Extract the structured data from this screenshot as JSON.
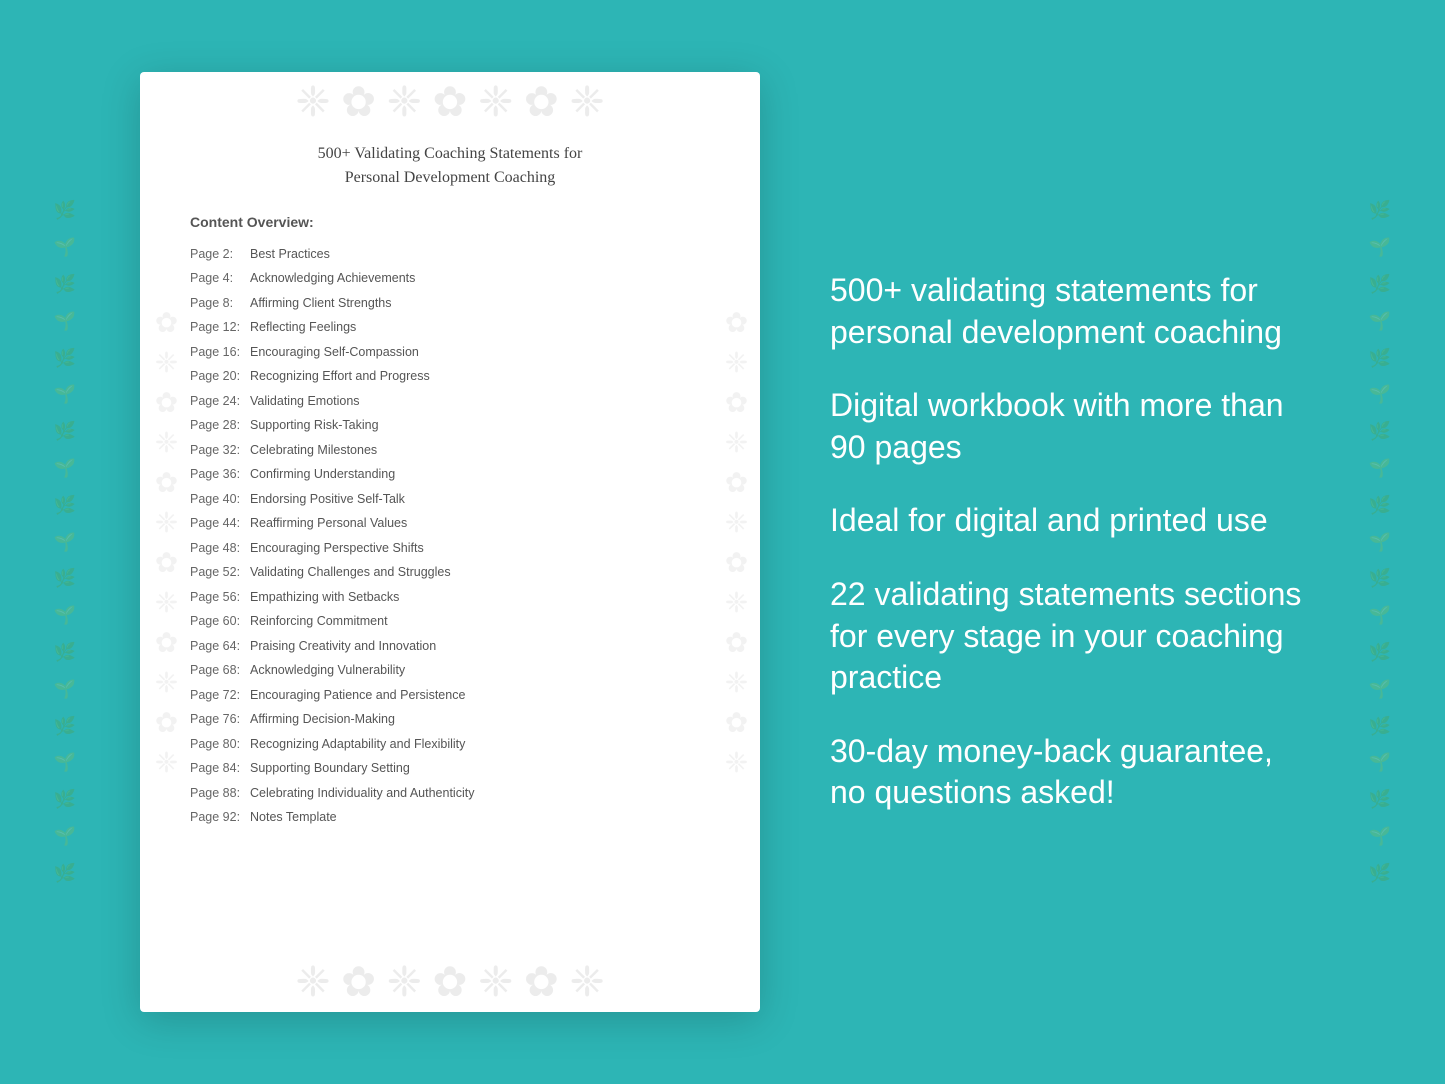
{
  "background": {
    "color": "#38bcbc"
  },
  "document": {
    "title_line1": "500+ Validating Coaching Statements for",
    "title_line2": "Personal Development Coaching",
    "content_heading": "Content Overview:",
    "toc": [
      {
        "page": "Page  2:",
        "topic": "Best Practices"
      },
      {
        "page": "Page  4:",
        "topic": "Acknowledging Achievements"
      },
      {
        "page": "Page  8:",
        "topic": "Affirming Client Strengths"
      },
      {
        "page": "Page 12:",
        "topic": "Reflecting Feelings"
      },
      {
        "page": "Page 16:",
        "topic": "Encouraging Self-Compassion"
      },
      {
        "page": "Page 20:",
        "topic": "Recognizing Effort and Progress"
      },
      {
        "page": "Page 24:",
        "topic": "Validating Emotions"
      },
      {
        "page": "Page 28:",
        "topic": "Supporting Risk-Taking"
      },
      {
        "page": "Page 32:",
        "topic": "Celebrating Milestones"
      },
      {
        "page": "Page 36:",
        "topic": "Confirming Understanding"
      },
      {
        "page": "Page 40:",
        "topic": "Endorsing Positive Self-Talk"
      },
      {
        "page": "Page 44:",
        "topic": "Reaffirming Personal Values"
      },
      {
        "page": "Page 48:",
        "topic": "Encouraging Perspective Shifts"
      },
      {
        "page": "Page 52:",
        "topic": "Validating Challenges and Struggles"
      },
      {
        "page": "Page 56:",
        "topic": "Empathizing with Setbacks"
      },
      {
        "page": "Page 60:",
        "topic": "Reinforcing Commitment"
      },
      {
        "page": "Page 64:",
        "topic": "Praising Creativity and Innovation"
      },
      {
        "page": "Page 68:",
        "topic": "Acknowledging Vulnerability"
      },
      {
        "page": "Page 72:",
        "topic": "Encouraging Patience and Persistence"
      },
      {
        "page": "Page 76:",
        "topic": "Affirming Decision-Making"
      },
      {
        "page": "Page 80:",
        "topic": "Recognizing Adaptability and Flexibility"
      },
      {
        "page": "Page 84:",
        "topic": "Supporting Boundary Setting"
      },
      {
        "page": "Page 88:",
        "topic": "Celebrating Individuality and Authenticity"
      },
      {
        "page": "Page 92:",
        "topic": "Notes Template"
      }
    ]
  },
  "features": [
    "500+ validating statements for personal development coaching",
    "Digital workbook with more than 90 pages",
    "Ideal for digital and printed use",
    "22 validating statements sections for every stage in your coaching practice",
    "30-day money-back guarantee, no questions asked!"
  ]
}
